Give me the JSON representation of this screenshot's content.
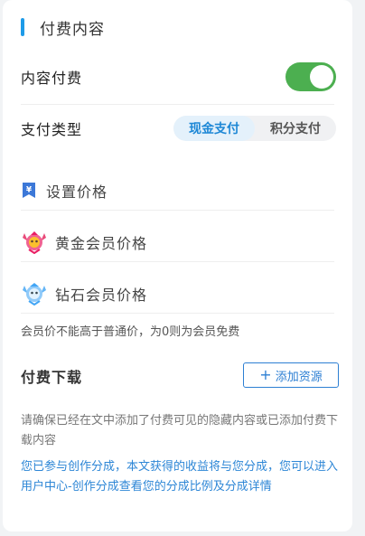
{
  "section": {
    "title": "付费内容"
  },
  "paid_content": {
    "label": "内容付费",
    "enabled": true
  },
  "payment_type": {
    "label": "支付类型",
    "options": [
      "现金支付",
      "积分支付"
    ],
    "selected": "现金支付"
  },
  "prices": [
    {
      "icon": "yuan-tag-icon",
      "label": "设置价格"
    },
    {
      "icon": "gold-member-badge-icon",
      "label": "黄金会员价格"
    },
    {
      "icon": "diamond-member-badge-icon",
      "label": "钻石会员价格"
    }
  ],
  "member_note": "会员价不能高于普通价，为0则为会员免费",
  "download": {
    "title": "付费下载",
    "add_button": "添加资源",
    "hint": "请确保已经在文中添加了付费可见的隐藏内容或已添加付费下载内容",
    "share_note": "您已参与创作分成，本文获得的收益将与您分成，您可以进入用户中心-创作分成查看您的分成比例及分成详情"
  },
  "colors": {
    "accent": "#1e9be8",
    "toggle_on": "#4caf50",
    "link": "#2d86d6"
  }
}
